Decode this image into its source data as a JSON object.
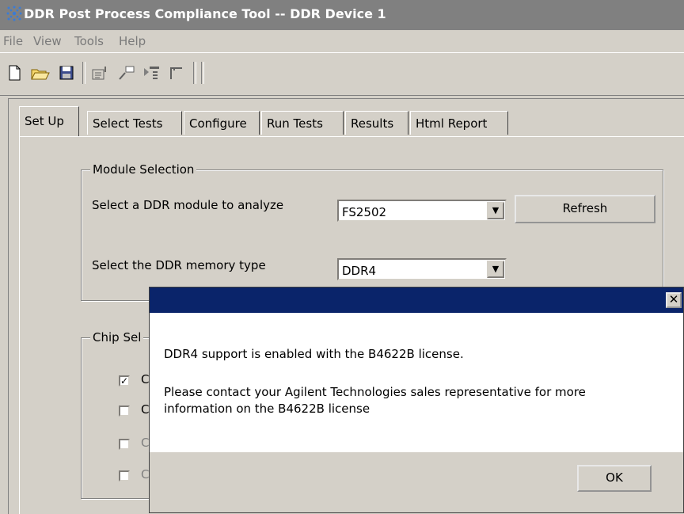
{
  "window": {
    "title": "DDR Post Process Compliance Tool -- DDR Device 1"
  },
  "menu": [
    "File",
    "View",
    "Tools",
    "Help"
  ],
  "toolbar": {
    "buttons": [
      "new-file-icon",
      "open-folder-icon",
      "save-icon",
      "report-icon",
      "run-icon",
      "select-tests-icon",
      "configure-icon"
    ]
  },
  "tabs": [
    "Set Up",
    "Select Tests",
    "Configure",
    "Run Tests",
    "Results",
    "Html Report"
  ],
  "module_selection": {
    "legend": "Module Selection",
    "module_label": "Select a DDR module to analyze",
    "module_value": "FS2502",
    "refresh_label": "Refresh",
    "memory_label": "Select the DDR memory type",
    "memory_value": "DDR4"
  },
  "chip_selection": {
    "legend": "Chip Sel",
    "items": [
      {
        "checked": true,
        "label": "C"
      },
      {
        "checked": false,
        "label": "C"
      },
      {
        "checked": false,
        "label": "C"
      },
      {
        "checked": false,
        "label": "C"
      }
    ]
  },
  "dialog": {
    "title": "",
    "line1": "DDR4 support is enabled with the B4622B license.",
    "line2": "Please contact your Agilent Technologies sales representative for more",
    "line3": "information on the B4622B license",
    "ok_label": "OK"
  }
}
